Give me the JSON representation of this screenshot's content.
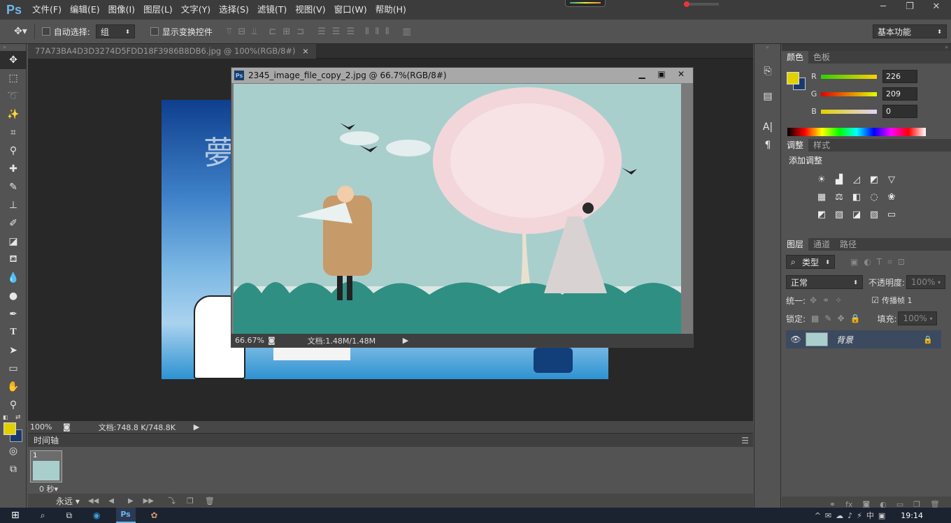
{
  "app": {
    "logo": "Ps"
  },
  "menu": [
    "文件(F)",
    "编辑(E)",
    "图像(I)",
    "图层(L)",
    "文字(Y)",
    "选择(S)",
    "滤镜(T)",
    "视图(V)",
    "窗口(W)",
    "帮助(H)"
  ],
  "window_controls": {
    "minimize": "─",
    "restore": "❐",
    "close": "✕"
  },
  "options": {
    "auto_select_label": "自动选择:",
    "auto_select_value": "组",
    "show_transform_label": "显示变换控件",
    "workspace": "基本功能"
  },
  "doc_tab": {
    "title": "77A73BA4D3D3274D5FDD18F3986B8DB6.jpg @ 100%(RGB/8#)",
    "close": "×"
  },
  "doc_status": {
    "zoom": "100%",
    "info": "文档:748.8 K/748.8K"
  },
  "float_window": {
    "title": "2345_image_file_copy_2.jpg @ 66.7%(RGB/8#)",
    "zoom": "66.67%",
    "info": "文档:1.48M/1.48M"
  },
  "timeline": {
    "title": "时间轴",
    "frame_number": "1",
    "frame_delay": "0 秒",
    "loop": "永远"
  },
  "color_panel": {
    "tabs": [
      "颜色",
      "色板"
    ],
    "fg_color": "#e2d100",
    "bg_color": "#1a3a6e",
    "r_label": "R",
    "g_label": "G",
    "b_label": "B",
    "r": "226",
    "g": "209",
    "b": "0"
  },
  "adjust_panel": {
    "tabs": [
      "调整",
      "样式"
    ],
    "title": "添加调整"
  },
  "layers_panel": {
    "tabs": [
      "图层",
      "通道",
      "路径"
    ],
    "filter": "类型",
    "blend_mode": "正常",
    "opacity_label": "不透明度:",
    "opacity": "100%",
    "unify_label": "统一:",
    "propagate_label": "传播帧 1",
    "lock_label": "锁定:",
    "fill_label": "填充:",
    "fill": "100%",
    "layer_name": "背景"
  },
  "taskbar": {
    "time": "19:14"
  },
  "accent": "#6fb6e8"
}
